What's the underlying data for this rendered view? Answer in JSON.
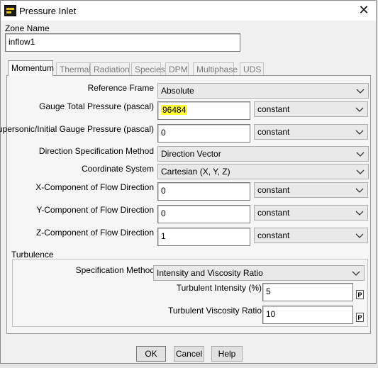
{
  "window": {
    "title": "Pressure Inlet",
    "icon": "app-logo-icon",
    "close_glyph": "✕"
  },
  "zone": {
    "label": "Zone Name",
    "value": "inflow1"
  },
  "tabs": [
    {
      "label": "Momentum",
      "active": true
    },
    {
      "label": "Thermal",
      "active": false
    },
    {
      "label": "Radiation",
      "active": false
    },
    {
      "label": "Species",
      "active": false
    },
    {
      "label": "DPM",
      "active": false
    },
    {
      "label": "Multiphase",
      "active": false
    },
    {
      "label": "UDS",
      "active": false
    }
  ],
  "momentum": {
    "reference_frame": {
      "label": "Reference Frame",
      "value": "Absolute"
    },
    "gauge_total_pressure": {
      "label": "Gauge Total Pressure (pascal)",
      "value": "96484",
      "profile": "constant",
      "highlight_color": "#ffff33"
    },
    "supersonic_pressure": {
      "label": "Supersonic/Initial Gauge Pressure (pascal)",
      "value": "0",
      "profile": "constant"
    },
    "direction_method": {
      "label": "Direction Specification Method",
      "value": "Direction Vector"
    },
    "coordinate_system": {
      "label": "Coordinate System",
      "value": "Cartesian (X, Y, Z)"
    },
    "x_component": {
      "label": "X-Component of Flow Direction",
      "value": "0",
      "profile": "constant"
    },
    "y_component": {
      "label": "Y-Component of Flow Direction",
      "value": "0",
      "profile": "constant"
    },
    "z_component": {
      "label": "Z-Component of Flow Direction",
      "value": "1",
      "profile": "constant"
    }
  },
  "turbulence": {
    "title": "Turbulence",
    "spec_method": {
      "label": "Specification Method",
      "value": "Intensity and Viscosity Ratio"
    },
    "intensity": {
      "label": "Turbulent Intensity (%)",
      "value": "5",
      "param": "P"
    },
    "viscosity_ratio": {
      "label": "Turbulent Viscosity Ratio",
      "value": "10",
      "param": "P"
    }
  },
  "buttons": {
    "ok": "OK",
    "cancel": "Cancel",
    "help": "Help"
  }
}
